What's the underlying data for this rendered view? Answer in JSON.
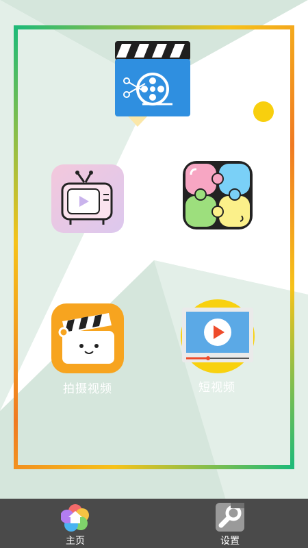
{
  "tiles": {
    "video_editor": {
      "label": ""
    },
    "tv_player": {
      "label": ""
    },
    "puzzle": {
      "label": ""
    },
    "camera": {
      "label": "拍摄视频"
    },
    "short_video": {
      "label": "短视频"
    }
  },
  "tabbar": {
    "home_label": "主页",
    "settings_label": "设置"
  },
  "colors": {
    "tabbar_bg": "#4a4a4a",
    "frame_green": "#1fba78",
    "frame_yellow": "#f6c21a",
    "frame_orange": "#f07a22",
    "background_shape": "#d5e6dc"
  }
}
